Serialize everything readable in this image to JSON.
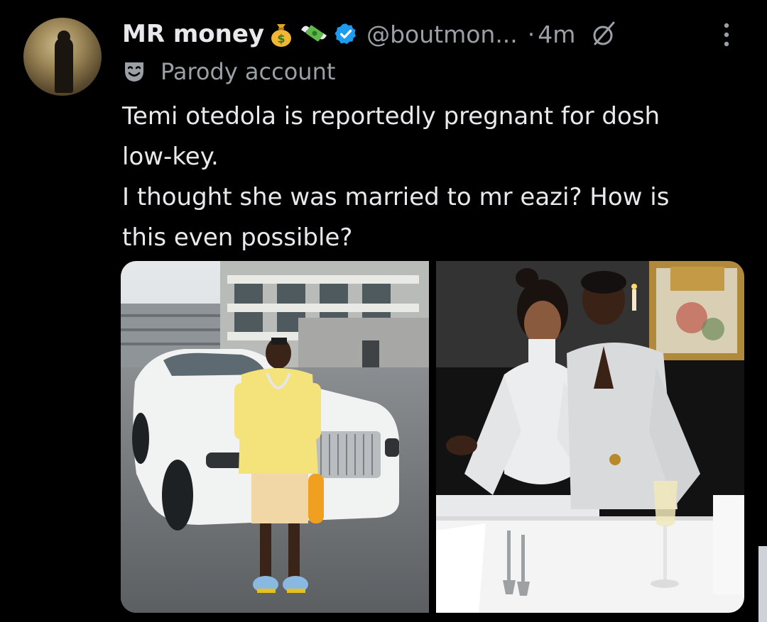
{
  "author": {
    "display_name": "MR money",
    "name_emojis": [
      "money-bag-emoji",
      "money-with-wings-emoji"
    ],
    "handle": "@boutmon...",
    "separator": "·",
    "time": "4m",
    "verified_color": "#1d9bf0"
  },
  "account_label": {
    "icon": "performing-arts-mask-icon",
    "text": "Parody account"
  },
  "tweet": {
    "lines": [
      "Temi otedola is reportedly pregnant for dosh",
      "low-key.",
      "I thought she was married to mr eazi? How is",
      "this even possible?"
    ]
  },
  "media": [
    {
      "description": "man-in-yellow-shirt-with-white-car",
      "icon": "photo"
    },
    {
      "description": "couple-in-white-at-restaurant",
      "icon": "photo"
    }
  ],
  "colors": {
    "background": "#000000",
    "text": "#e7e9ea",
    "secondary": "#9aa0a6",
    "accent": "#1d9bf0"
  }
}
